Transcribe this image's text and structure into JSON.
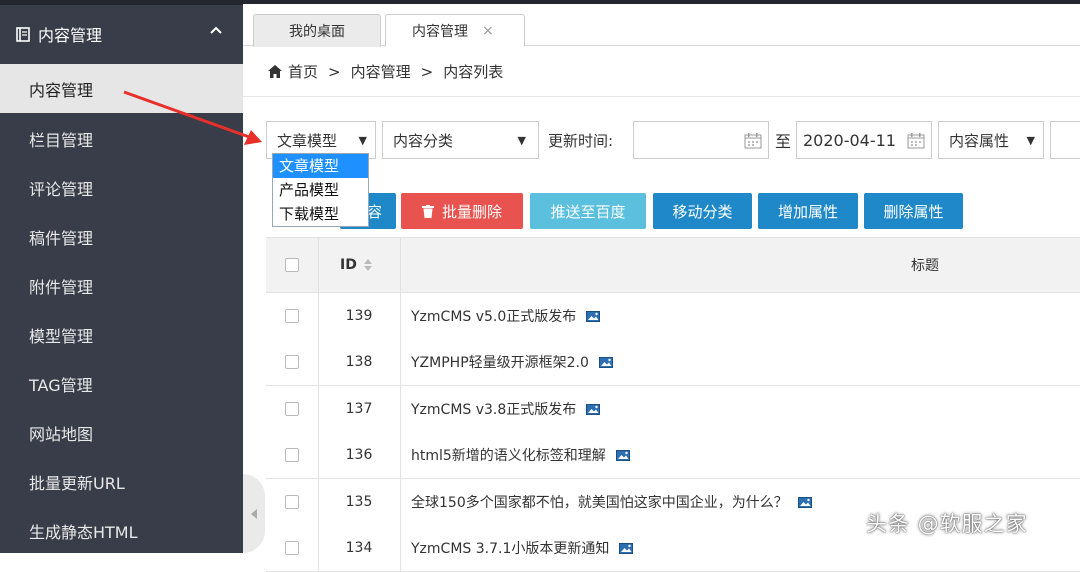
{
  "sidebar": {
    "header": "内容管理",
    "items": [
      "内容管理",
      "栏目管理",
      "评论管理",
      "稿件管理",
      "附件管理",
      "模型管理",
      "TAG管理",
      "网站地图",
      "批量更新URL",
      "生成静态HTML"
    ],
    "active_index": 0
  },
  "tabs": [
    {
      "label": "我的桌面"
    },
    {
      "label": "内容管理",
      "close": "×"
    }
  ],
  "breadcrumb": {
    "home": "首页",
    "sep": ">",
    "items": [
      "内容管理",
      "内容列表"
    ]
  },
  "filter": {
    "model": {
      "value": "文章模型",
      "options": [
        "文章模型",
        "产品模型",
        "下载模型"
      ]
    },
    "category": {
      "value": "内容分类"
    },
    "time_label": "更新时间:",
    "date_start": "",
    "to": "至",
    "date_end": "2020-04-11",
    "attribute": {
      "value": "内容属性"
    }
  },
  "buttons": {
    "add_partial": "容",
    "batch_delete": "批量删除",
    "push_baidu": "推送至百度",
    "move_category": "移动分类",
    "add_attr": "增加属性",
    "del_attr": "删除属性"
  },
  "table": {
    "headers": {
      "id": "ID",
      "title": "标题"
    },
    "rows": [
      {
        "id": "139",
        "title": "YzmCMS v5.0正式版发布"
      },
      {
        "id": "138",
        "title": "YZMPHP轻量级开源框架2.0"
      },
      {
        "id": "137",
        "title": "YzmCMS v3.8正式版发布"
      },
      {
        "id": "136",
        "title": "html5新增的语义化标签和理解"
      },
      {
        "id": "135",
        "title": "全球150多个国家都不怕，就美国怕这家中国企业，为什么？"
      },
      {
        "id": "134",
        "title": "YzmCMS 3.7.1小版本更新通知"
      }
    ]
  },
  "watermark": "头条 @软服之家",
  "colors": {
    "sidebar_bg": "#393D49",
    "highlight": "#1E90FF",
    "danger": "#E9534F",
    "info": "#5BC0DE",
    "primary": "#1E88C8",
    "annotation": "#E8302A"
  }
}
